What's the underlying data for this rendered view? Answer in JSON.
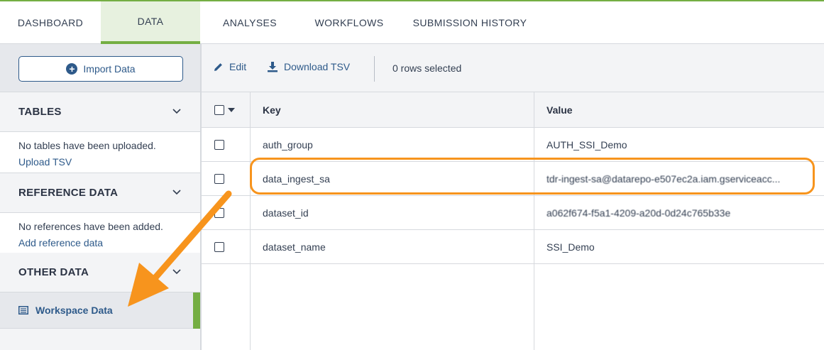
{
  "nav": {
    "tabs": [
      {
        "label": "DASHBOARD"
      },
      {
        "label": "DATA"
      },
      {
        "label": "ANALYSES"
      },
      {
        "label": "WORKFLOWS"
      },
      {
        "label": "SUBMISSION HISTORY"
      }
    ],
    "active_tab": "DATA",
    "accent_color": "#74ae43"
  },
  "sidebar": {
    "import_label": "Import Data",
    "sections": [
      {
        "title": "TABLES",
        "message": "No tables have been uploaded.",
        "link": "Upload TSV"
      },
      {
        "title": "REFERENCE DATA",
        "message": "No references have been added.",
        "link": "Add reference data"
      },
      {
        "title": "OTHER DATA"
      }
    ],
    "selected_item": "Workspace Data"
  },
  "toolbar": {
    "edit_label": "Edit",
    "download_label": "Download TSV",
    "rows_selected": "0 rows selected"
  },
  "table": {
    "columns": [
      "Key",
      "Value"
    ],
    "rows": [
      {
        "key": "auth_group",
        "value": "AUTH_SSI_Demo"
      },
      {
        "key": "data_ingest_sa",
        "value": "tdr-ingest-sa@datarepo-e507ec2a.iam.gserviceacc..."
      },
      {
        "key": "dataset_id",
        "value": "a062f674-f5a1-4209-a20d-0d24c765b33e"
      },
      {
        "key": "dataset_name",
        "value": "SSI_Demo"
      }
    ]
  },
  "annotation_color": "#f7941d"
}
